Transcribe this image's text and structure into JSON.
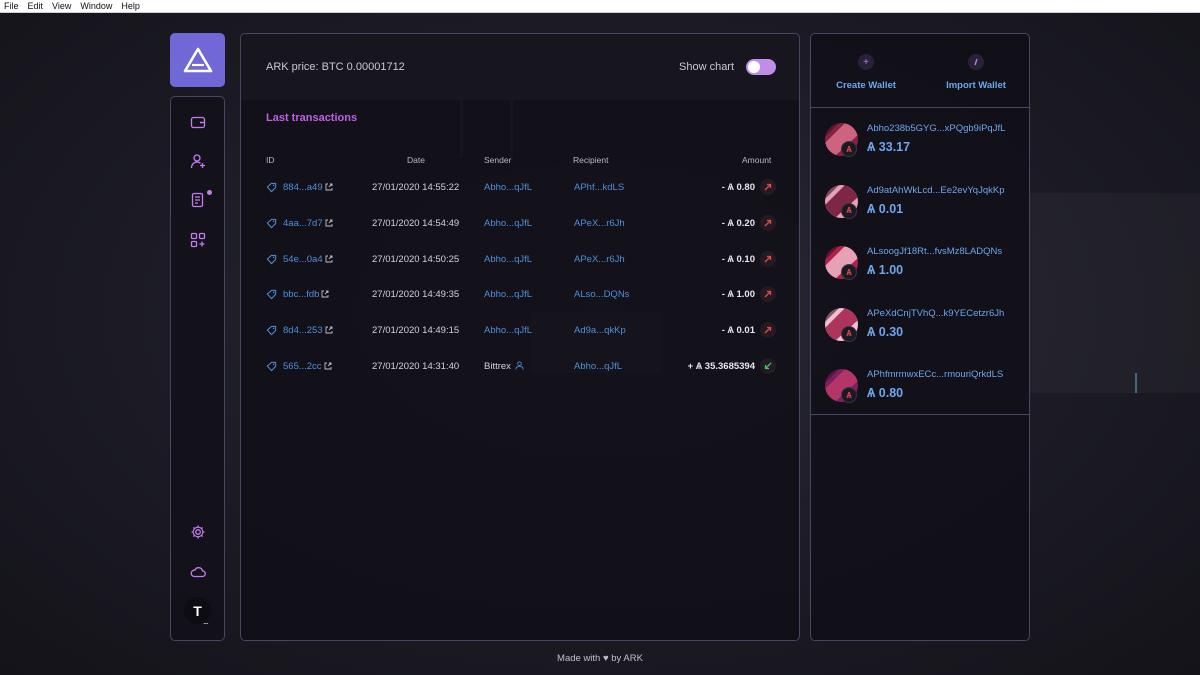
{
  "os_menu": [
    "File",
    "Edit",
    "View",
    "Window",
    "Help"
  ],
  "sidebar": {
    "avatar_letter": "T",
    "avatar_more": "...",
    "icons": [
      "wallet-icon",
      "add-contact-icon",
      "announcements-icon",
      "plugins-icon",
      "settings-icon",
      "network-cloud-icon"
    ]
  },
  "header": {
    "price_label": "ARK price: BTC 0.00001712",
    "show_chart_label": "Show chart",
    "show_chart_on": true
  },
  "transactions": {
    "title": "Last transactions",
    "columns": [
      "ID",
      "Date",
      "Sender",
      "Recipient",
      "Amount"
    ],
    "rows": [
      {
        "id": "884...a49",
        "date": "27/01/2020 14:55:22",
        "sender": "Abho...qJfL",
        "recipient": "APhf...kdLS",
        "amount": "- Ѧ 0.80",
        "direction": "out"
      },
      {
        "id": "4aa...7d7",
        "date": "27/01/2020 14:54:49",
        "sender": "Abho...qJfL",
        "recipient": "APeX...r6Jh",
        "amount": "- Ѧ 0.20",
        "direction": "out"
      },
      {
        "id": "54e...0a4",
        "date": "27/01/2020 14:50:25",
        "sender": "Abho...qJfL",
        "recipient": "APeX...r6Jh",
        "amount": "- Ѧ 0.10",
        "direction": "out"
      },
      {
        "id": "bbc...fdb",
        "date": "27/01/2020 14:49:35",
        "sender": "Abho...qJfL",
        "recipient": "ALso...DQNs",
        "amount": "- Ѧ 1.00",
        "direction": "out"
      },
      {
        "id": "8d4...253",
        "date": "27/01/2020 14:49:15",
        "sender": "Abho...qJfL",
        "recipient": "Ad9a...qkKp",
        "amount": "- Ѧ 0.01",
        "direction": "out"
      },
      {
        "id": "565...2cc",
        "date": "27/01/2020 14:31:40",
        "sender": "Bittrex",
        "recipient": "Abho...qJfL",
        "amount": "+ Ѧ 35.3685394",
        "direction": "in"
      }
    ]
  },
  "wallet_actions": {
    "create_label": "Create Wallet",
    "import_label": "Import Wallet"
  },
  "wallets": [
    {
      "address": "Abho238b5GYG...xPQgb9iPqJfL",
      "balance": "Ѧ 33.17",
      "color_a": "#8a1f44",
      "color_b": "#d9708a"
    },
    {
      "address": "Ad9atAhWkLcd...Ee2evYqJqkKp",
      "balance": "Ѧ 0.01",
      "color_a": "#e8a0b8",
      "color_b": "#6a1030"
    },
    {
      "address": "ALsoogJf18Rt...fvsMz8LADQNs",
      "balance": "Ѧ 1.00",
      "color_a": "#b0204a",
      "color_b": "#f0b8c8"
    },
    {
      "address": "APeXdCnjTVhQ...k9YECetzr6Jh",
      "balance": "Ѧ 0.30",
      "color_a": "#f4c0d0",
      "color_b": "#a01c48"
    },
    {
      "address": "APhfmrmwxECc...rmouriQrkdLS",
      "balance": "Ѧ 0.80",
      "color_a": "#7a2060",
      "color_b": "#c03a6a"
    }
  ],
  "footer": "Made with ♥ by ARK",
  "colors": {
    "accent": "#c05ee8",
    "link": "#4f8fd8",
    "logo_bg": "#6f68d6"
  }
}
